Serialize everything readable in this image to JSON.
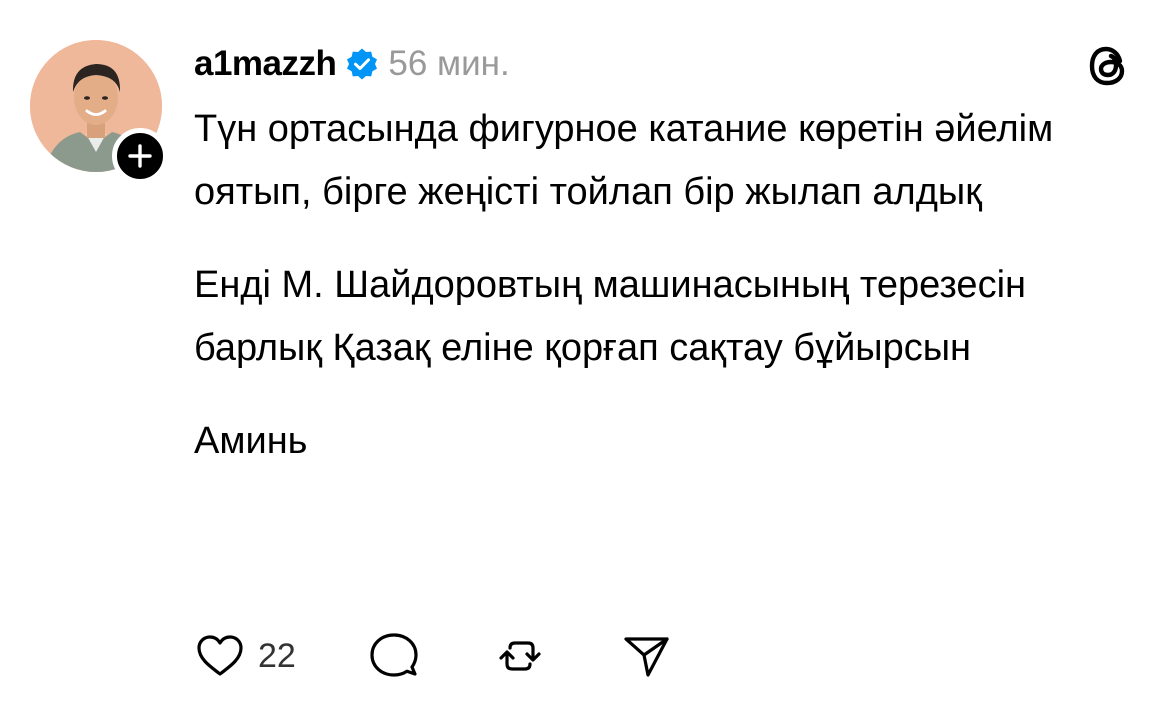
{
  "post": {
    "username": "a1mazzh",
    "timestamp": "56 мин.",
    "paragraphs": [
      "Түн ортасында фигурное катание көретін әйелім оятып, бірге жеңісті тойлап бір жылап алдық",
      "Енді М. Шайдоровтың машинасының терезесін барлық Қазақ еліне қорғап сақтау бұйырсын",
      "Аминь"
    ],
    "likes": "22"
  },
  "icons": {
    "avatar": "avatar",
    "follow": "plus-icon",
    "verified": "verified-badge-icon",
    "app_logo": "threads-logo-icon",
    "like": "heart-icon",
    "comment": "comment-bubble-icon",
    "repost": "repost-icon",
    "share": "send-icon"
  },
  "colors": {
    "verified_blue": "#0095f6",
    "text": "#000000",
    "muted": "#999999"
  }
}
